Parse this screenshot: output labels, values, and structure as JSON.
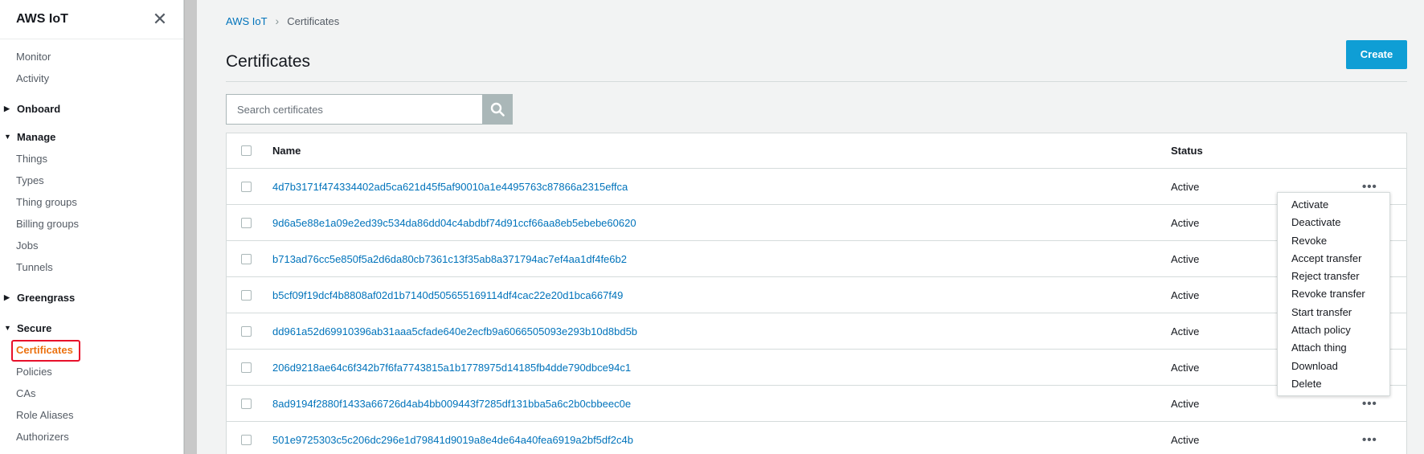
{
  "sidebar": {
    "title": "AWS IoT",
    "close_glyph": "✕",
    "top_items": [
      "Monitor",
      "Activity"
    ],
    "sections": [
      {
        "label": "Onboard",
        "expanded": false,
        "items": []
      },
      {
        "label": "Manage",
        "expanded": true,
        "items": [
          "Things",
          "Types",
          "Thing groups",
          "Billing groups",
          "Jobs",
          "Tunnels"
        ]
      },
      {
        "label": "Greengrass",
        "expanded": false,
        "items": []
      },
      {
        "label": "Secure",
        "expanded": true,
        "items": [
          "Certificates",
          "Policies",
          "CAs",
          "Role Aliases",
          "Authorizers"
        ]
      }
    ],
    "active_item": "Certificates"
  },
  "breadcrumb": {
    "root": "AWS IoT",
    "current": "Certificates"
  },
  "page": {
    "title": "Certificates",
    "create_label": "Create"
  },
  "search": {
    "placeholder": "Search certificates",
    "value": ""
  },
  "table": {
    "columns": {
      "name": "Name",
      "status": "Status"
    },
    "rows": [
      {
        "name": "4d7b3171f474334402ad5ca621d45f5af90010a1e4495763c87866a2315effca",
        "status": "Active"
      },
      {
        "name": "9d6a5e88e1a09e2ed39c534da86dd04c4abdbf74d91ccf66aa8eb5ebebe60620",
        "status": "Active"
      },
      {
        "name": "b713ad76cc5e850f5a2d6da80cb7361c13f35ab8a371794ac7ef4aa1df4fe6b2",
        "status": "Active"
      },
      {
        "name": "b5cf09f19dcf4b8808af02d1b7140d505655169114df4cac22e20d1bca667f49",
        "status": "Active"
      },
      {
        "name": "dd961a52d69910396ab31aaa5cfade640e2ecfb9a6066505093e293b10d8bd5b",
        "status": "Active"
      },
      {
        "name": "206d9218ae64c6f342b7f6fa7743815a1b1778975d14185fb4dde790dbce94c1",
        "status": "Active"
      },
      {
        "name": "8ad9194f2880f1433a66726d4ab4bb009443f7285df131bba5a6c2b0cbbeec0e",
        "status": "Active"
      },
      {
        "name": "501e9725303c5c206dc296e1d79841d9019a8e4de64a40fea6919a2bf5df2c4b",
        "status": "Active"
      }
    ],
    "more_glyph": "•••"
  },
  "actions_menu": {
    "items": [
      "Activate",
      "Deactivate",
      "Revoke",
      "Accept transfer",
      "Reject transfer",
      "Revoke transfer",
      "Start transfer",
      "Attach policy",
      "Attach thing",
      "Download",
      "Delete"
    ]
  },
  "colors": {
    "link": "#0073bb",
    "primary_button": "#0f9ed5",
    "active_nav": "#ec7211",
    "highlight_box": "#e8102a"
  }
}
